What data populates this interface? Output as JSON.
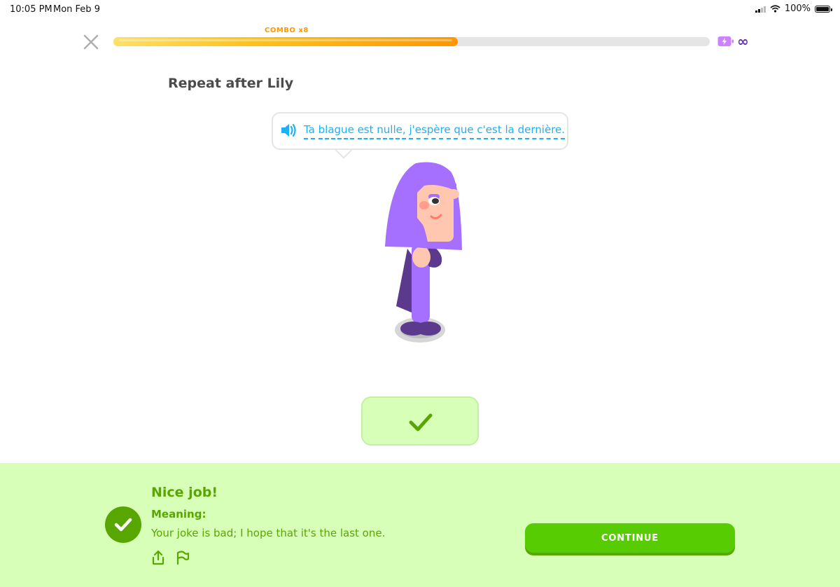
{
  "status_bar": {
    "time": "10:05 PM",
    "date": "Mon Feb 9",
    "battery_percent": "100%"
  },
  "progress": {
    "fraction": 0.577,
    "combo_label": "COMBO x8",
    "energy_label": "∞"
  },
  "exercise": {
    "prompt": "Repeat after Lily",
    "phrase_words": [
      "Ta",
      "blague",
      "est",
      "nulle,",
      "j'espère",
      "que",
      "c'est",
      "la",
      "dernière."
    ]
  },
  "feedback": {
    "title": "Nice job!",
    "meaning_label": "Meaning:",
    "meaning_text": "Your joke is bad; I hope that it's the last one.",
    "continue_label": "CONTINUE"
  },
  "colors": {
    "correct_green": "#58a700",
    "feedback_bg": "#d7ffb8",
    "button_green": "#58cc02",
    "word_blue": "#1cb0f6",
    "combo_orange": "#ff9600",
    "character_hair": "#a570ff"
  },
  "icons": [
    "close-icon",
    "energy-icon",
    "speaker-icon",
    "checkmark-icon",
    "share-icon",
    "flag-icon",
    "wifi-icon",
    "battery-icon",
    "signal-icon"
  ]
}
